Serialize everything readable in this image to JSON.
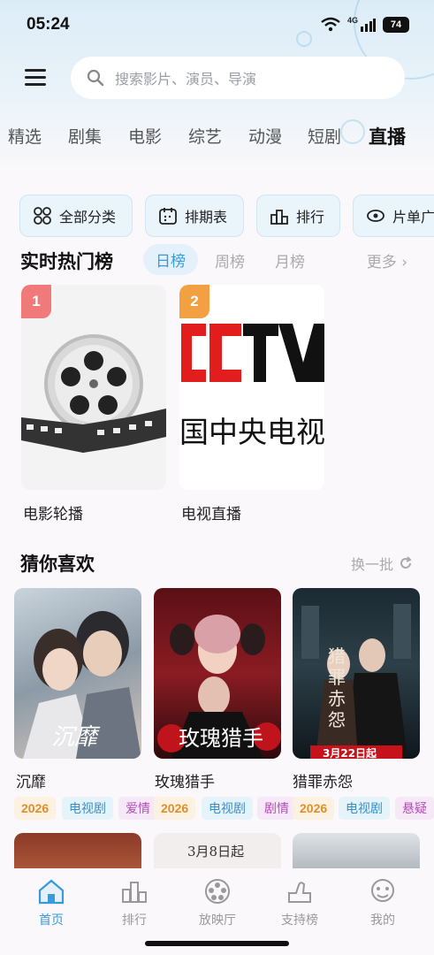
{
  "status": {
    "time": "05:24",
    "network": "4G",
    "battery": "74"
  },
  "search": {
    "placeholder": "搜索影片、演员、导演"
  },
  "tabs": [
    "精选",
    "剧集",
    "电影",
    "综艺",
    "动漫",
    "短剧",
    "直播"
  ],
  "active_tab": "直播",
  "quick_links": [
    "全部分类",
    "排期表",
    "排行",
    "片单广"
  ],
  "hot_section": {
    "title": "实时热门榜",
    "rank_tabs": [
      "日榜",
      "周榜",
      "月榜"
    ],
    "more": "更多",
    "items": [
      {
        "rank": "1",
        "label": "电影轮播",
        "color": "#f07a7a"
      },
      {
        "rank": "2",
        "label": "电视直播",
        "color": "#f2a041",
        "logo_text": "国中央电视"
      }
    ]
  },
  "guess_section": {
    "title": "猜你喜欢",
    "refresh": "换一批",
    "items": [
      {
        "title": "沉靡",
        "poster_text": "沉靡",
        "year": "2026",
        "type": "电视剧",
        "genre": "爱情"
      },
      {
        "title": "玫瑰猎手",
        "poster_text": "玫瑰猎手",
        "year": "2026",
        "type": "电视剧",
        "genre": "剧情"
      },
      {
        "title": "猎罪赤怨",
        "poster_text": "猎罪赤怨",
        "poster_date": "3月22日起",
        "year": "2026",
        "type": "电视剧",
        "genre": "悬疑"
      }
    ],
    "next_row_texts": [
      "3月8日起"
    ]
  },
  "bottom_nav": [
    "首页",
    "排行",
    "放映厅",
    "支持榜",
    "我的"
  ],
  "colors": {
    "accent": "#3a9ad9",
    "rank1": "#f07a7a",
    "rank2": "#f2a041"
  }
}
